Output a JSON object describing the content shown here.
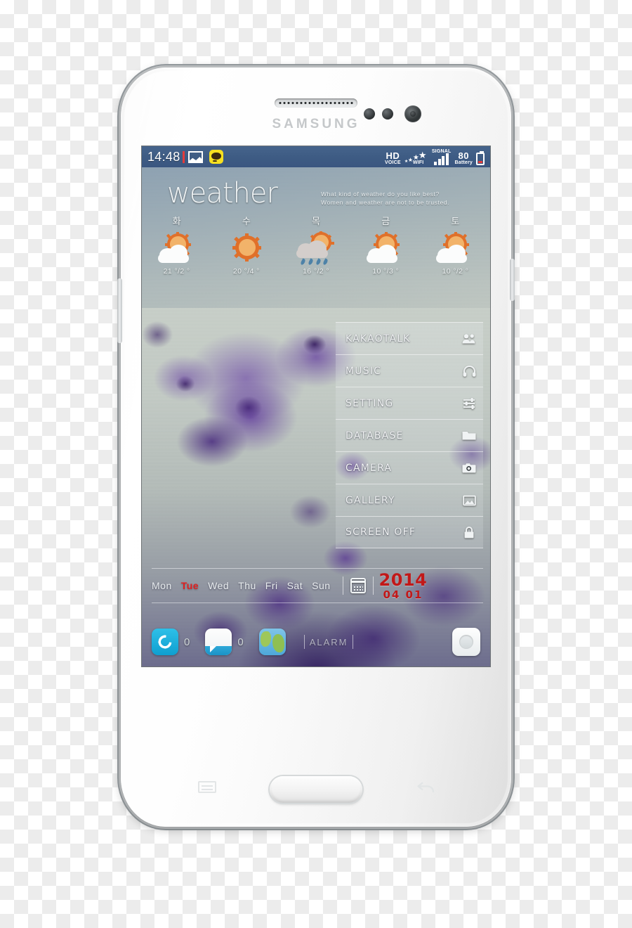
{
  "device": {
    "brand": "SAMSUNG"
  },
  "status_bar": {
    "time": "14:48",
    "left_icons": [
      {
        "name": "image-icon",
        "label": "image"
      },
      {
        "name": "kakaotalk-icon",
        "label": "TALK"
      }
    ],
    "hd_voice": {
      "line1": "HD",
      "line2": "VOICE"
    },
    "wifi": {
      "label": "WIFI"
    },
    "signal": {
      "label": "SIGNAL",
      "bars": 4
    },
    "battery": {
      "level": "80",
      "label": "Battery"
    }
  },
  "weather": {
    "title": "weather",
    "tagline_line1": "What kind of weather do you like best?",
    "tagline_line2": "Women and weather are not to be trusted.",
    "forecast": [
      {
        "day": "화",
        "icon": "sun-behind-cloud",
        "temp": "21 °/2 °",
        "high": 21,
        "low": 2
      },
      {
        "day": "수",
        "icon": "sun",
        "temp": "20 °/4 °",
        "high": 20,
        "low": 4
      },
      {
        "day": "목",
        "icon": "rain-with-sun",
        "temp": "16 °/2 °",
        "high": 16,
        "low": 2
      },
      {
        "day": "금",
        "icon": "sun-behind-cloud",
        "temp": "10 °/3 °",
        "high": 10,
        "low": 3
      },
      {
        "day": "토",
        "icon": "sun-behind-cloud",
        "temp": "10 °/2 °",
        "high": 10,
        "low": 2
      }
    ]
  },
  "menu": {
    "items": [
      {
        "label": "KAKAOTALK",
        "icon": "people-icon"
      },
      {
        "label": "MUSIC",
        "icon": "headphones-icon"
      },
      {
        "label": "SETTING",
        "icon": "sliders-icon"
      },
      {
        "label": "DATABASE",
        "icon": "folder-icon"
      },
      {
        "label": "CAMERA",
        "icon": "camera-icon"
      },
      {
        "label": "GALLERY",
        "icon": "picture-icon"
      },
      {
        "label": "SCREEN OFF",
        "icon": "lock-icon"
      }
    ]
  },
  "daybar": {
    "days": [
      {
        "label": "Mon",
        "active": false
      },
      {
        "label": "Tue",
        "active": true
      },
      {
        "label": "Wed",
        "active": false
      },
      {
        "label": "Thu",
        "active": false
      },
      {
        "label": "Fri",
        "active": false
      },
      {
        "label": "Sat",
        "active": false
      },
      {
        "label": "Sun",
        "active": false
      }
    ],
    "calendar_icon": "calendar-icon",
    "year": "2014",
    "month_day": "04 01",
    "accent_color": "#c21818"
  },
  "dock": {
    "phone": {
      "icon": "phone-icon",
      "count": "0"
    },
    "messages": {
      "icon": "message-icon",
      "count": "0"
    },
    "browser": {
      "icon": "globe-icon"
    },
    "alarm": {
      "label": "ALARM"
    },
    "app_drawer": {
      "icon": "apps-grid-icon"
    }
  },
  "hardware": {
    "menu_key": "menu-key-icon",
    "home_button": "home-button",
    "back_key": "back-key-icon"
  }
}
